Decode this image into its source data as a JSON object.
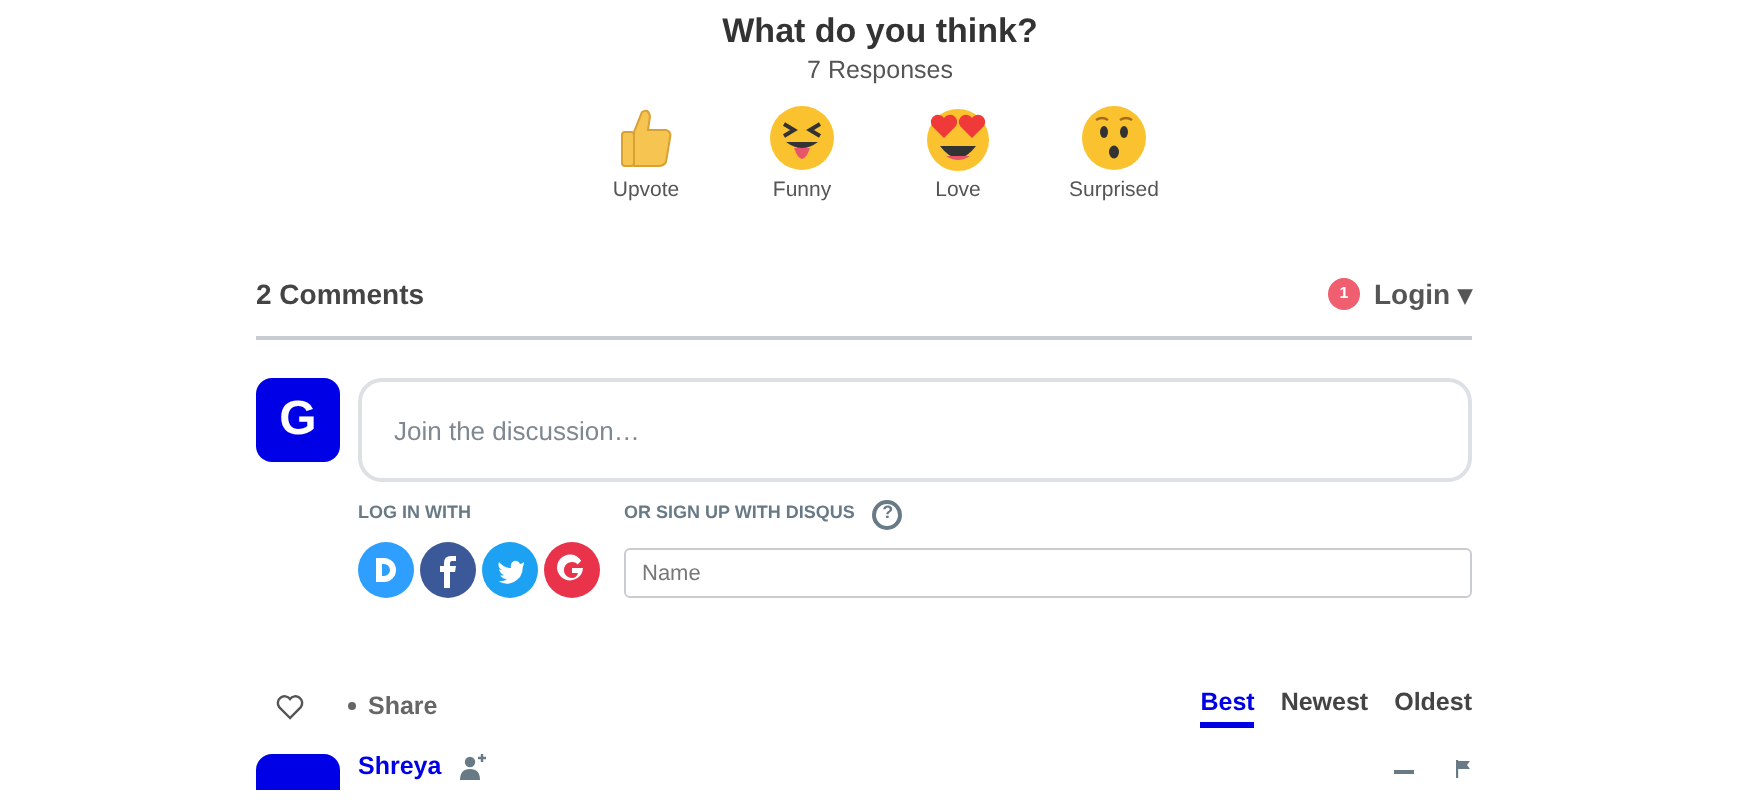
{
  "header": {
    "title": "What do you think?",
    "responses": "7 Responses"
  },
  "reactions": [
    {
      "kind": "upvote",
      "label": "Upvote"
    },
    {
      "kind": "funny",
      "label": "Funny"
    },
    {
      "kind": "love",
      "label": "Love"
    },
    {
      "kind": "surprised",
      "label": "Surprised"
    }
  ],
  "comments_bar": {
    "count": "2 Comments",
    "notification_badge": "1",
    "login": "Login ▾"
  },
  "composer": {
    "avatar_letter": "G",
    "placeholder": "Join the discussion…",
    "log_in_with": "LOG IN WITH",
    "sign_up": "OR SIGN UP WITH DISQUS",
    "help": "?",
    "name_placeholder": "Name",
    "providers": [
      {
        "kind": "disqus"
      },
      {
        "kind": "facebook"
      },
      {
        "kind": "twitter"
      },
      {
        "kind": "google"
      }
    ]
  },
  "toolbar": {
    "share": "Share"
  },
  "sort_tabs": [
    {
      "label": "Best",
      "selected": true
    },
    {
      "label": "Newest",
      "selected": false
    },
    {
      "label": "Oldest",
      "selected": false
    }
  ],
  "comments": [
    {
      "author": "Shreya"
    }
  ]
}
